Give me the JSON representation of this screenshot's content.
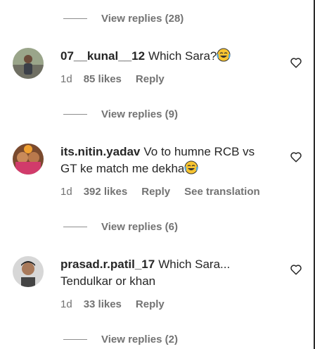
{
  "thread": [
    {
      "replies_label": "View replies (28)"
    },
    {
      "username": "07__kunal__12",
      "text": "Which Sara?",
      "emoji": "😂",
      "age": "1d",
      "likes": "85 likes",
      "reply": "Reply",
      "replies_label": "View replies (9)"
    },
    {
      "username": "its.nitin.yadav",
      "text": "Vo to humne RCB vs GT ke match me dekha",
      "emoji": "😂",
      "age": "1d",
      "likes": "392 likes",
      "reply": "Reply",
      "translate": "See translation",
      "replies_label": "View replies (6)"
    },
    {
      "username": "prasad.r.patil_17",
      "text": "Which Sara... Tendulkar or khan",
      "age": "1d",
      "likes": "33 likes",
      "reply": "Reply",
      "replies_label": "View replies (2)"
    }
  ],
  "icons": {
    "like": "heart-outline-icon",
    "emoji": "face-with-tears-of-joy"
  },
  "colors": {
    "text": "#262626",
    "muted": "#737373",
    "line": "#8e8e8e"
  }
}
